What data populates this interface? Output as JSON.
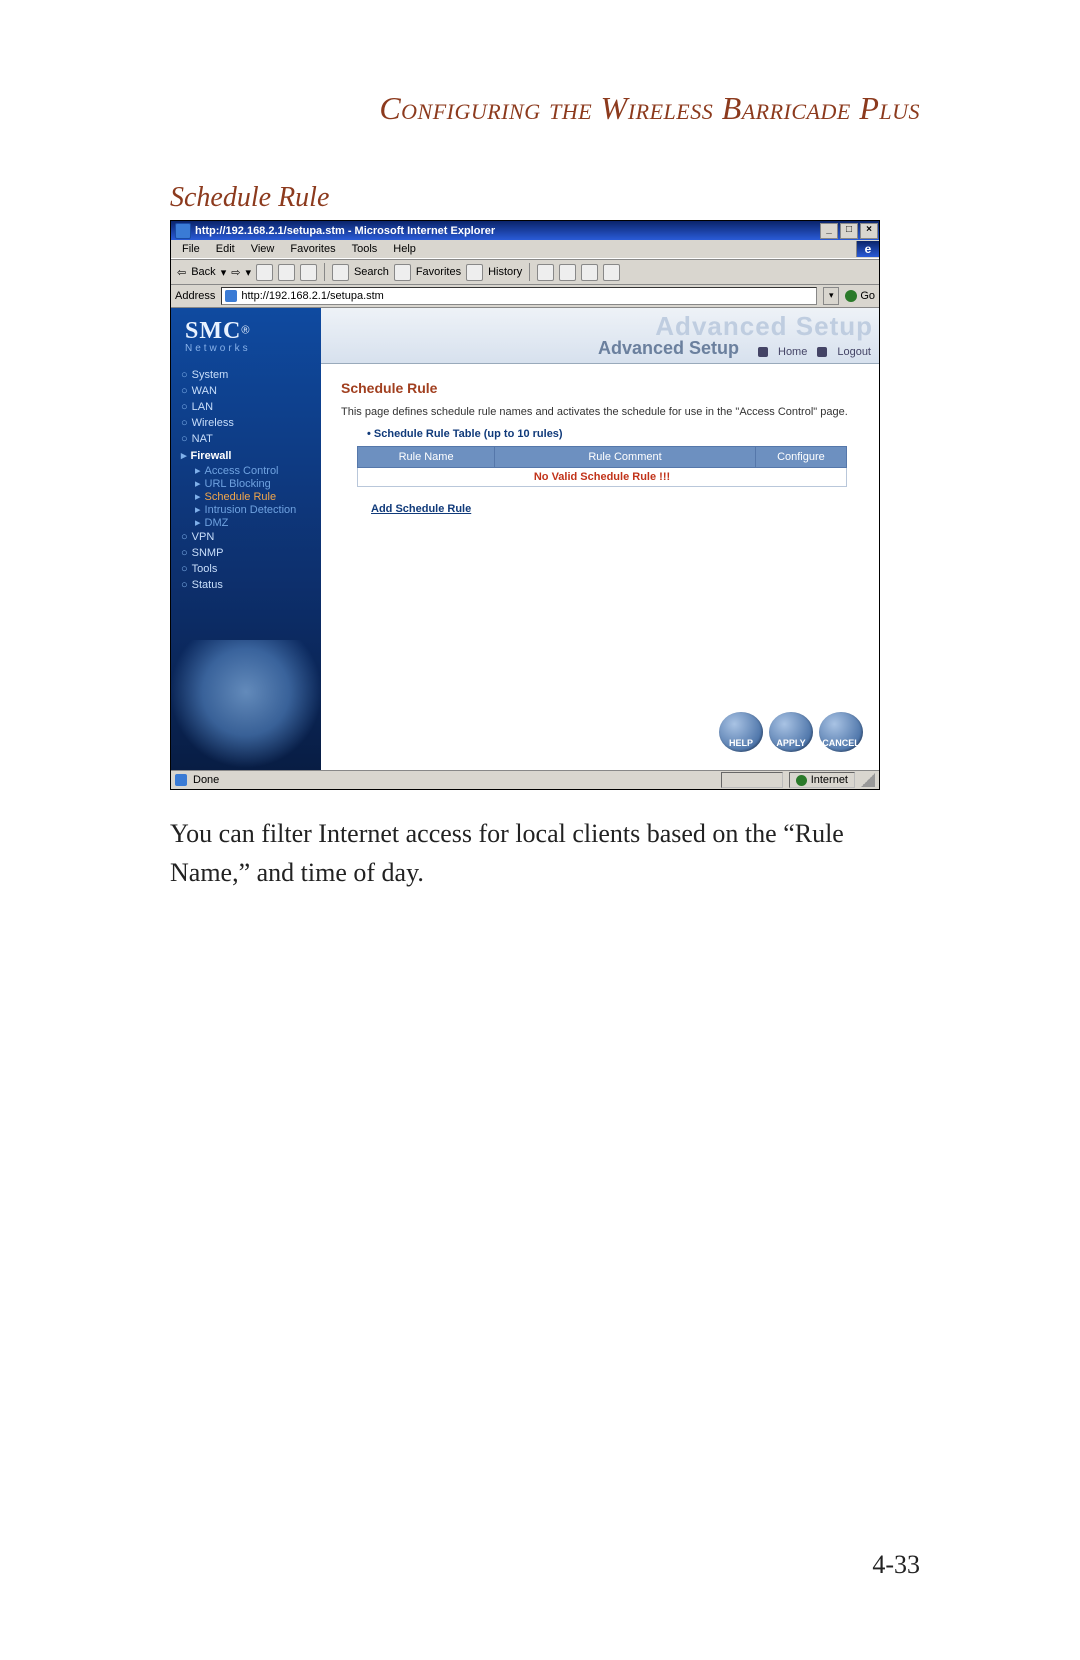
{
  "doc": {
    "title": "Configuring the Wireless Barricade Plus",
    "subtitle": "Schedule Rule",
    "body": "You can filter Internet access for local clients based on the “Rule Name,” and time of day.",
    "page_num": "4-33"
  },
  "window": {
    "title": "http://192.168.2.1/setupa.stm - Microsoft Internet Explorer",
    "min": "_",
    "max": "□",
    "close": "×"
  },
  "menu": {
    "file": "File",
    "edit": "Edit",
    "view": "View",
    "favorites": "Favorites",
    "tools": "Tools",
    "help": "Help"
  },
  "toolbar": {
    "back": "Back",
    "search": "Search",
    "favorites": "Favorites",
    "history": "History"
  },
  "address": {
    "label": "Address",
    "url": "http://192.168.2.1/setupa.stm",
    "go": "Go"
  },
  "brand": {
    "name": "SMC",
    "reg": "®",
    "networks": "Networks"
  },
  "nav": {
    "system": "System",
    "wan": "WAN",
    "lan": "LAN",
    "wireless": "Wireless",
    "nat": "NAT",
    "firewall": "Firewall",
    "access_control": "Access Control",
    "url_blocking": "URL Blocking",
    "schedule_rule": "Schedule Rule",
    "intrusion": "Intrusion Detection",
    "dmz": "DMZ",
    "vpn": "VPN",
    "snmp": "SNMP",
    "tools": "Tools",
    "status": "Status"
  },
  "hero": {
    "ghost": "Advanced Setup",
    "adv": "Advanced Setup",
    "home": "Home",
    "logout": "Logout"
  },
  "panel": {
    "heading": "Schedule Rule",
    "desc": "This page defines schedule rule names and activates the schedule for use in the \"Access Control\" page.",
    "tbl_title": "Schedule Rule Table (up to 10 rules)",
    "col_name": "Rule Name",
    "col_comment": "Rule Comment",
    "col_configure": "Configure",
    "no_valid": "No Valid Schedule Rule !!!",
    "add_link": "Add Schedule Rule"
  },
  "buttons": {
    "help": "HELP",
    "apply": "APPLY",
    "cancel": "CANCEL"
  },
  "status": {
    "done": "Done",
    "zone": "Internet"
  }
}
